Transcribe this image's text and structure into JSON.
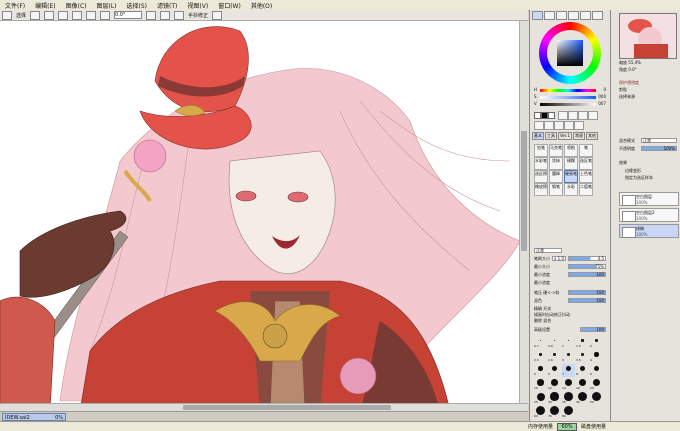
{
  "menu": [
    "文件(F)",
    "编辑(E)",
    "图像(C)",
    "图层(L)",
    "选择(S)",
    "滤镜(T)",
    "视图(V)",
    "窗口(W)",
    "其他(O)"
  ],
  "toolbar": {
    "select_label": "选择",
    "zoom_value": "0.0°",
    "flip_label": "手抖修正"
  },
  "tab": {
    "name": "IDEW.sai2",
    "zoom": "0%"
  },
  "status": {
    "memory_label": "内存使用量",
    "memory_value": "60%",
    "disk_label": "磁盘使用量"
  },
  "color": {
    "sliders": [
      {
        "label": "H",
        "value": "0"
      },
      {
        "label": "S",
        "value": "000"
      },
      {
        "label": "V",
        "value": "007"
      }
    ]
  },
  "tool_tabs": [
    "基本",
    "工具",
    "Ver.1",
    "常规",
    "其他"
  ],
  "tool_grid": [
    [
      "铅笔",
      "马克笔",
      "喷枪",
      "笔"
    ],
    [
      "水彩笔",
      "涂抹",
      "模糊",
      "选区笔"
    ],
    [
      "选区擦",
      "魔棒",
      "硬画笔",
      "上色笔"
    ],
    [
      "橡皮擦",
      "钢笔",
      "水彩",
      "二值笔"
    ]
  ],
  "tool_props": {
    "mode": "正常",
    "brush_size_label": "笔刷大小",
    "brush_size": "x 1.0",
    "brush_size_val": "4.5",
    "min_size_label": "最小大小",
    "min_size": "75%",
    "density_label": "最小浓度",
    "min_density": "100",
    "min_opacity_label": "最小浓度",
    "blend_label": "混色",
    "blend_value": "100",
    "pressure_label": "笔压 硬<->软",
    "pressure_value": "100",
    "check1": "精确 开关",
    "check2": "描画时自动修正抖动",
    "check3": "删除 混合",
    "texture_label": "高级设置",
    "texture_value": "100",
    "brush_sizes": [
      "0.7",
      "0.8",
      "1",
      "1.5",
      "2",
      "2.3",
      "2.6",
      "3",
      "3.5",
      "4",
      "5",
      "6",
      "7",
      "8",
      "9",
      "10",
      "12",
      "14",
      "16",
      "20",
      "25",
      "30",
      "35",
      "40",
      "50",
      "60",
      "70",
      "80"
    ]
  },
  "layer_panel": {
    "nav_zoom": "缩放 55.4%",
    "nav_angle": "角度 0.0°",
    "protect_label": "保护透明度",
    "clip_label": "剪贴",
    "select_src_label": "选择来源",
    "mode_label": "混合模式",
    "mode_value": "正常",
    "opacity_label": "不透明度",
    "opacity_value": "100%",
    "effect_label": "效果",
    "effect1": "边缘变形",
    "effect2": "指定为选区样本",
    "layers": [
      {
        "name": "空白图层",
        "pct": "100%"
      },
      {
        "name": "空白图层2",
        "pct": "100%"
      },
      {
        "name": "线稿",
        "pct": "100%"
      }
    ]
  },
  "colors": {
    "accent": "#5c86d6",
    "hat": "#e3534a",
    "hair": "#f3c9cf",
    "coat": "#c64235",
    "glove": "#6b3a30",
    "gold": "#d9a84a"
  }
}
